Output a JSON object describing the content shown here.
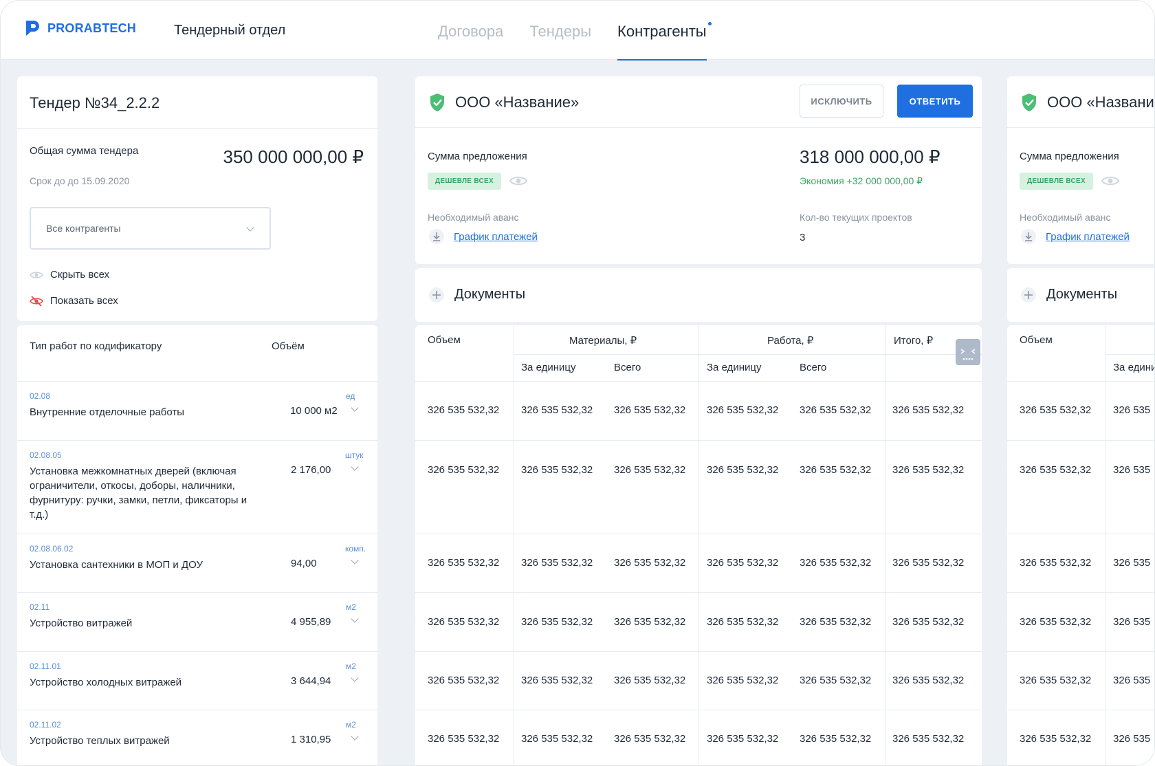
{
  "header": {
    "logo_text": "PRORABTECH",
    "department": "Тендерный отдел",
    "tabs": [
      "Договора",
      "Тендеры",
      "Контрагенты"
    ]
  },
  "tender": {
    "title": "Тендер №34_2.2.2",
    "total_label": "Общая сумма тендера",
    "total_value": "350 000 000,00 ₽",
    "deadline": "Срок до до 15.09.2020",
    "filter_value": "Все контрагенты",
    "hide_all": "Скрыть всех",
    "show_all": "Показать всех"
  },
  "works": {
    "col_type": "Тип работ по кодификатору",
    "col_volume": "Объём",
    "rows": [
      {
        "code": "02.08",
        "title": "Внутренние отделочные работы",
        "volume": "10 000 м2",
        "unit": "ед"
      },
      {
        "code": "02.08.05",
        "title": "Установка межкомнатных дверей (включая ограничители, откосы, доборы, наличники, фурнитуру: ручки, замки, петли, фиксаторы и т.д.)",
        "volume": "2 176,00",
        "unit": "штук"
      },
      {
        "code": "02.08.06.02",
        "title": "Установка сантехники в МОП и ДОУ",
        "volume": "94,00",
        "unit": "комп."
      },
      {
        "code": "02.11",
        "title": "Устройство витражей",
        "volume": "4 955,89",
        "unit": "м2"
      },
      {
        "code": "02.11.01",
        "title": "Устройство холодных витражей",
        "volume": "3 644,94",
        "unit": "м2"
      },
      {
        "code": "02.11.02",
        "title": "Устройство теплых витражей",
        "volume": "1 310,95",
        "unit": "м2"
      }
    ]
  },
  "contractor": {
    "name": "ООО «Название»",
    "exclude_label": "ИСКЛЮЧИТЬ",
    "reply_label": "ОТВЕТИТЬ",
    "offer_label": "Сумма предложения",
    "offer_value": "318 000 000,00 ₽",
    "cheapest_badge": "ДЕШЕВЛЕ ВСЕХ",
    "savings": "Экономия +32 000 000,00 ₽",
    "advance_label": "Необходимый аванс",
    "schedule_link": "График платежей",
    "projects_label": "Кол-во текущих проектов",
    "projects_value": "3",
    "documents_label": "Документы"
  },
  "contractor2": {
    "name": "ООО «Название»",
    "offer_label": "Сумма предложения",
    "cheapest_badge": "ДЕШЕВЛЕ ВСЕХ",
    "advance_label": "Необходимый аванс",
    "schedule_link": "График платежей",
    "documents_label": "Документы",
    "col_volume": "Объем",
    "col_unit": "За едини",
    "row_values": [
      "326 535 532,32",
      "326 535 532,32",
      "326 535 532,32",
      "326 535 532,32",
      "326 535 532,32",
      "326 535 532,32"
    ],
    "row_values_cut": [
      "326 535",
      "326 535",
      "326 535",
      "326 535",
      "326 535",
      "326 535"
    ]
  },
  "table": {
    "col_volume": "Объем",
    "col_materials": "Материалы, ₽",
    "col_work": "Работа, ₽",
    "col_total": "Итого, ₽",
    "sub_unit": "За единицу",
    "sub_total": "Всего",
    "rows": [
      [
        "326 535 532,32",
        "326 535 532,32",
        "326 535 532,32",
        "326 535 532,32",
        "326 535 532,32",
        "326 535 532,32"
      ],
      [
        "326 535 532,32",
        "326 535 532,32",
        "326 535 532,32",
        "326 535 532,32",
        "326 535 532,32",
        "326 535 532,32"
      ],
      [
        "326 535 532,32",
        "326 535 532,32",
        "326 535 532,32",
        "326 535 532,32",
        "326 535 532,32",
        "326 535 532,32"
      ],
      [
        "326 535 532,32",
        "326 535 532,32",
        "326 535 532,32",
        "326 535 532,32",
        "326 535 532,32",
        "326 535 532,32"
      ],
      [
        "326 535 532,32",
        "326 535 532,32",
        "326 535 532,32",
        "326 535 532,32",
        "326 535 532,32",
        "326 535 532,32"
      ],
      [
        "326 535 532,32",
        "326 535 532,32",
        "326 535 532,32",
        "326 535 532,32",
        "326 535 532,32",
        "326 535 532,32"
      ]
    ]
  },
  "colors": {
    "accent": "#1f6fe0",
    "success": "#3aa463",
    "badge_bg": "#d7f1e0",
    "danger": "#e5484d"
  }
}
